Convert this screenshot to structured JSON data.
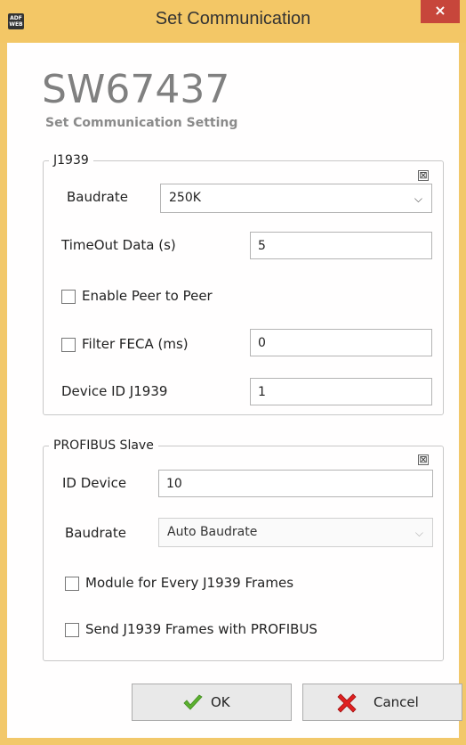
{
  "window": {
    "title": "Set Communication",
    "logo_text": [
      "ADF",
      "WEB"
    ],
    "close_glyph": "×"
  },
  "header": {
    "product": "SW67437",
    "subtitle": "Set Communication Setting"
  },
  "j1939": {
    "legend": "J1939",
    "collapse_glyph": "⊠",
    "baudrate_label": "Baudrate",
    "baudrate_value": "250K",
    "timeout_label": "TimeOut Data (s)",
    "timeout_value": "5",
    "enable_peer_label": "Enable Peer to Peer",
    "enable_peer_checked": false,
    "filter_feca_label": "Filter FECA (ms)",
    "filter_feca_checked": false,
    "filter_feca_value": "0",
    "device_id_label": "Device ID J1939",
    "device_id_value": "1"
  },
  "profibus": {
    "legend": "PROFIBUS Slave",
    "collapse_glyph": "⊠",
    "id_device_label": "ID Device",
    "id_device_value": "10",
    "baudrate_label": "Baudrate",
    "baudrate_value": "Auto Baudrate",
    "module_every_label": "Module for Every J1939 Frames",
    "module_every_checked": false,
    "send_frames_label": "Send J1939 Frames with PROFIBUS",
    "send_frames_checked": false
  },
  "buttons": {
    "ok_label": "OK",
    "cancel_label": "Cancel"
  },
  "colors": {
    "frame": "#f3c766",
    "close": "#c7463b",
    "ok_icon": "#5cb130",
    "cancel_icon": "#e02020"
  }
}
